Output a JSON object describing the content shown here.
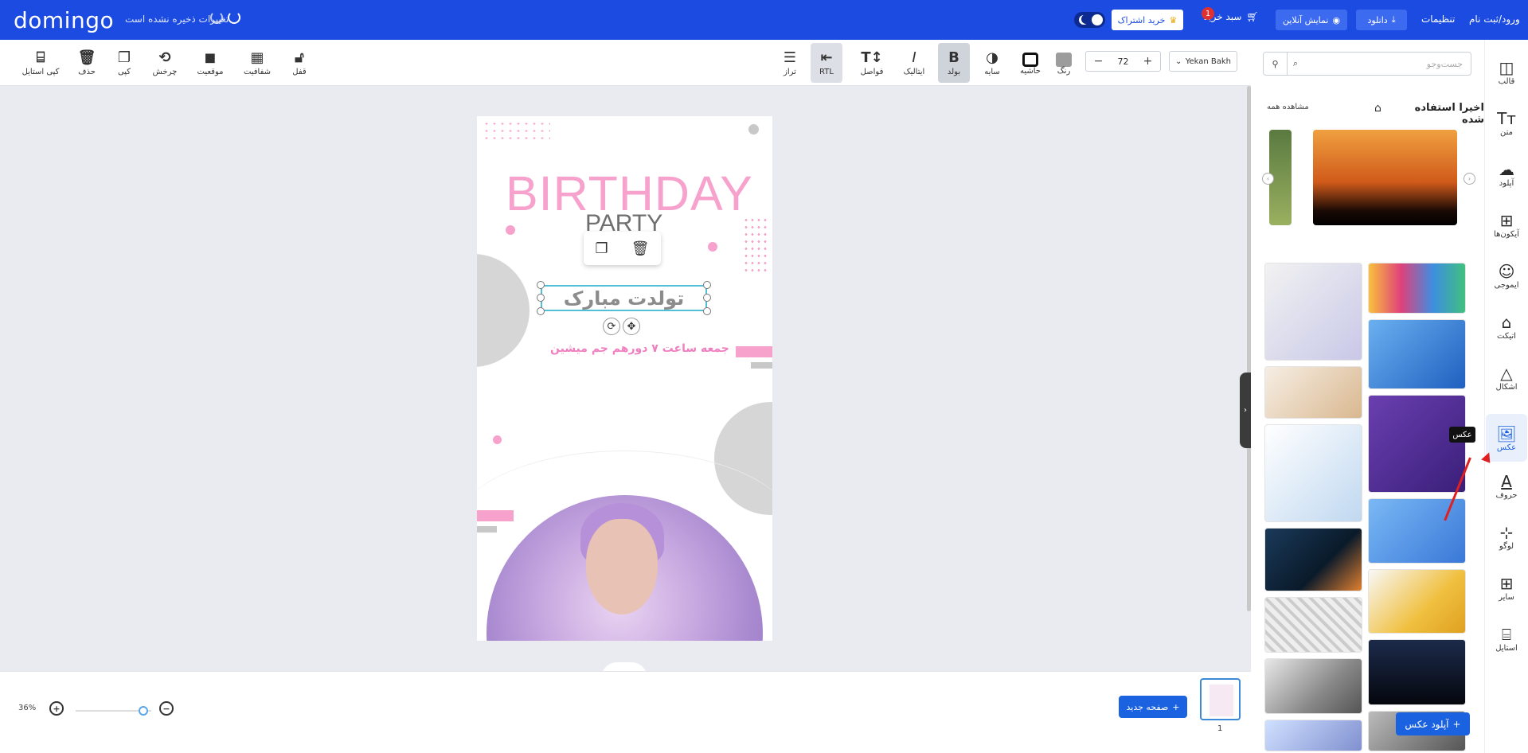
{
  "header": {
    "logo": "domingo",
    "unsaved_status": "تغییرات ذخیره نشده است",
    "subscribe_label": "خرید اشتراک",
    "cart_label": "سبد خرید",
    "cart_count": "1",
    "preview_label": "نمایش آنلاین",
    "download_label": "دانلود",
    "settings_label": "تنظیمات",
    "login_label": "ورود/ثبت نام"
  },
  "toolbar": {
    "font_name": "Yekan Bakh",
    "font_size": "72",
    "color_label": "رنگ",
    "border_label": "حاشیه",
    "shadow_label": "سایه",
    "bold_label": "بولد",
    "italic_label": "ایتالیک",
    "spacing_label": "فواصل",
    "rtl_label": "RTL",
    "align_label": "تراز",
    "lock_label": "قفل",
    "opacity_label": "شفافیت",
    "position_label": "موقعیت",
    "rotate_label": "چرخش",
    "copy_label": "کپی",
    "delete_label": "حذف",
    "copy_style_label": "کپی استایل"
  },
  "canvas": {
    "headline": "BIRTHDAY",
    "subheadline": "PARTY",
    "selected_text": "تولدت مبارک",
    "info_text": "جمعه ساعت ۷ دورهم جم میشین",
    "accent_color": "#f7a2cd"
  },
  "bottom": {
    "zoom": "36%",
    "zoom_fraction": 0.36,
    "new_page_label": "صفحه جدید",
    "page_number": "1"
  },
  "panel": {
    "search_placeholder": "جست‌وجو",
    "recent_title": "اخیرا استفاده شده",
    "see_all": "مشاهده همه",
    "upload_label": "آپلود عکس",
    "grid_images": [
      "warehouse",
      "questions",
      "logistics-ship",
      "logistics-isometric",
      "supply-chain",
      "logistics-purple",
      "logistics-map",
      "warehouse-blue",
      "ai-laptop",
      "world-shipping",
      "white-cubes",
      "hacker",
      "damaged-car",
      "network"
    ]
  },
  "sidenav": {
    "items": [
      {
        "label": "قالب",
        "icon": "template-icon"
      },
      {
        "label": "متن",
        "icon": "text-icon"
      },
      {
        "label": "آپلود",
        "icon": "upload-icon"
      },
      {
        "label": "آیکون‌ها",
        "icon": "grid-icon"
      },
      {
        "label": "ایموجی",
        "icon": "emoji-icon"
      },
      {
        "label": "اتیکت",
        "icon": "tag-icon"
      },
      {
        "label": "اشکال",
        "icon": "shapes-icon"
      },
      {
        "label": "عکس",
        "icon": "image-icon"
      },
      {
        "label": "حروف",
        "icon": "letters-icon"
      },
      {
        "label": "لوگو",
        "icon": "logo-icon"
      },
      {
        "label": "سایر",
        "icon": "more-icon"
      },
      {
        "label": "استایل",
        "icon": "style-icon"
      }
    ],
    "tooltip": "عکس"
  }
}
